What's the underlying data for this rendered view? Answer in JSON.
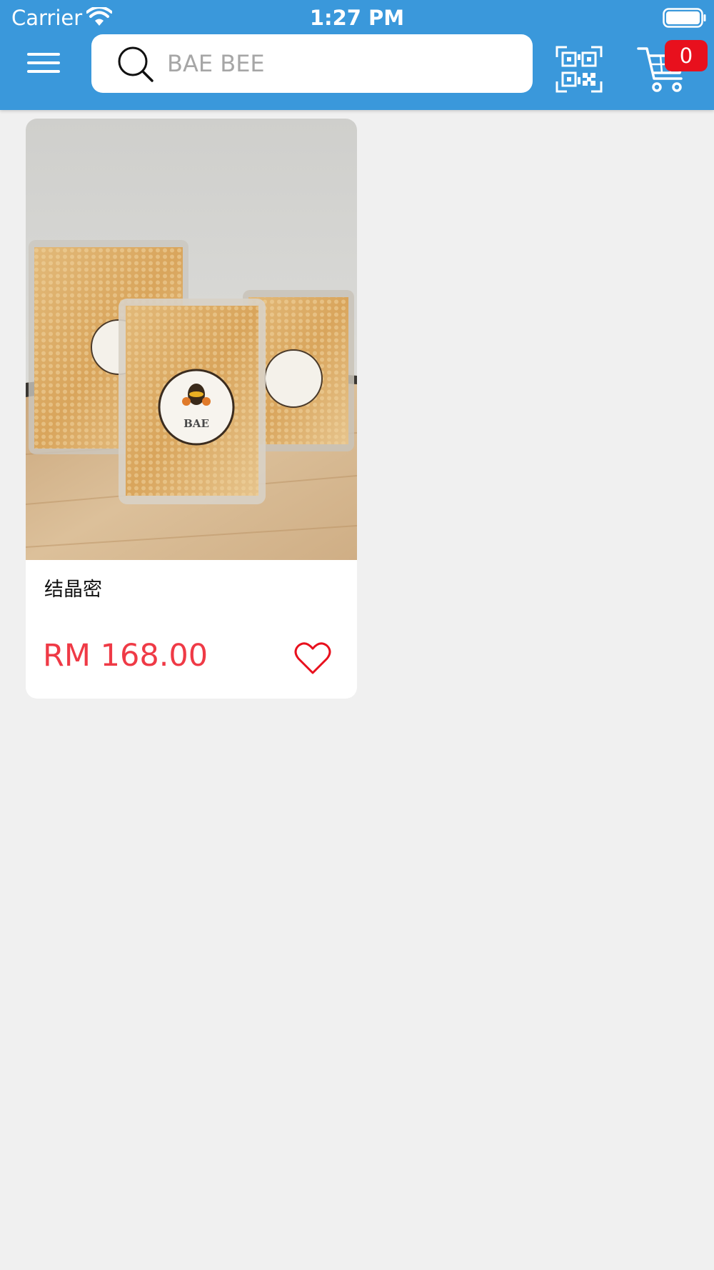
{
  "status_bar": {
    "carrier": "Carrier",
    "time": "1:27 PM"
  },
  "header": {
    "menu_icon": "hamburger-menu-icon",
    "search": {
      "placeholder": "BAE BEE",
      "value": "",
      "icon": "search-icon"
    },
    "qr_icon": "qr-code-scan-icon",
    "cart": {
      "icon": "shopping-cart-icon",
      "count": "0"
    },
    "colors": {
      "header_bg": "#3a98db",
      "badge_bg": "#e8101d"
    }
  },
  "products": [
    {
      "image_label": "BAE BEE",
      "name": "结晶密",
      "price": "RM 168.00",
      "wishlist_icon": "heart-icon"
    }
  ],
  "colors": {
    "price": "#ef3a46",
    "page_bg": "#f0f0f0"
  }
}
